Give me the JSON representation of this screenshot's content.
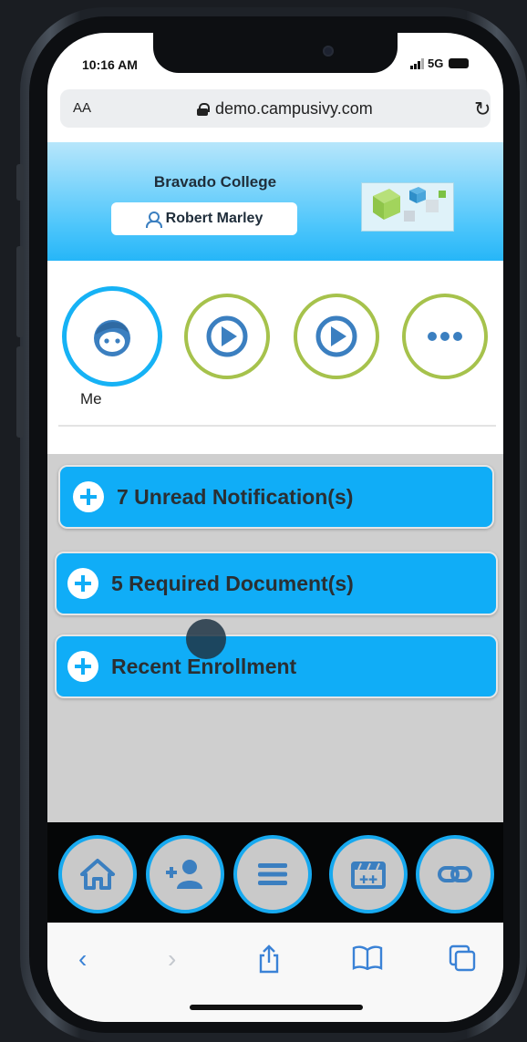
{
  "status_bar": {
    "time": "10:16 AM",
    "network": "5G"
  },
  "browser": {
    "text_size_label": "AA",
    "url": "demo.campusivy.com"
  },
  "header": {
    "college_name": "Bravado College",
    "user_name": "Robert Marley"
  },
  "quick_actions": [
    {
      "label": "Me",
      "icon": "face-icon"
    },
    {
      "label": "",
      "icon": "play-icon"
    },
    {
      "label": "",
      "icon": "play-icon"
    },
    {
      "label": "",
      "icon": "more-icon"
    }
  ],
  "accordions": [
    {
      "label": "7 Unread Notification(s)"
    },
    {
      "label": "5 Required Document(s)"
    },
    {
      "label": "Recent Enrollment"
    }
  ],
  "bottom_nav": [
    {
      "icon": "home-icon"
    },
    {
      "icon": "add-user-icon"
    },
    {
      "icon": "menu-icon"
    },
    {
      "icon": "clapperboard-icon"
    },
    {
      "icon": "link-icon"
    }
  ],
  "safari_toolbar": [
    "back-icon",
    "forward-icon",
    "share-icon",
    "bookmarks-icon",
    "tabs-icon"
  ],
  "colors": {
    "accent": "#10adf7",
    "ring_green": "#a6c24c",
    "nav_ring": "#17a9ef",
    "icon_blue": "#3b7fc0"
  }
}
